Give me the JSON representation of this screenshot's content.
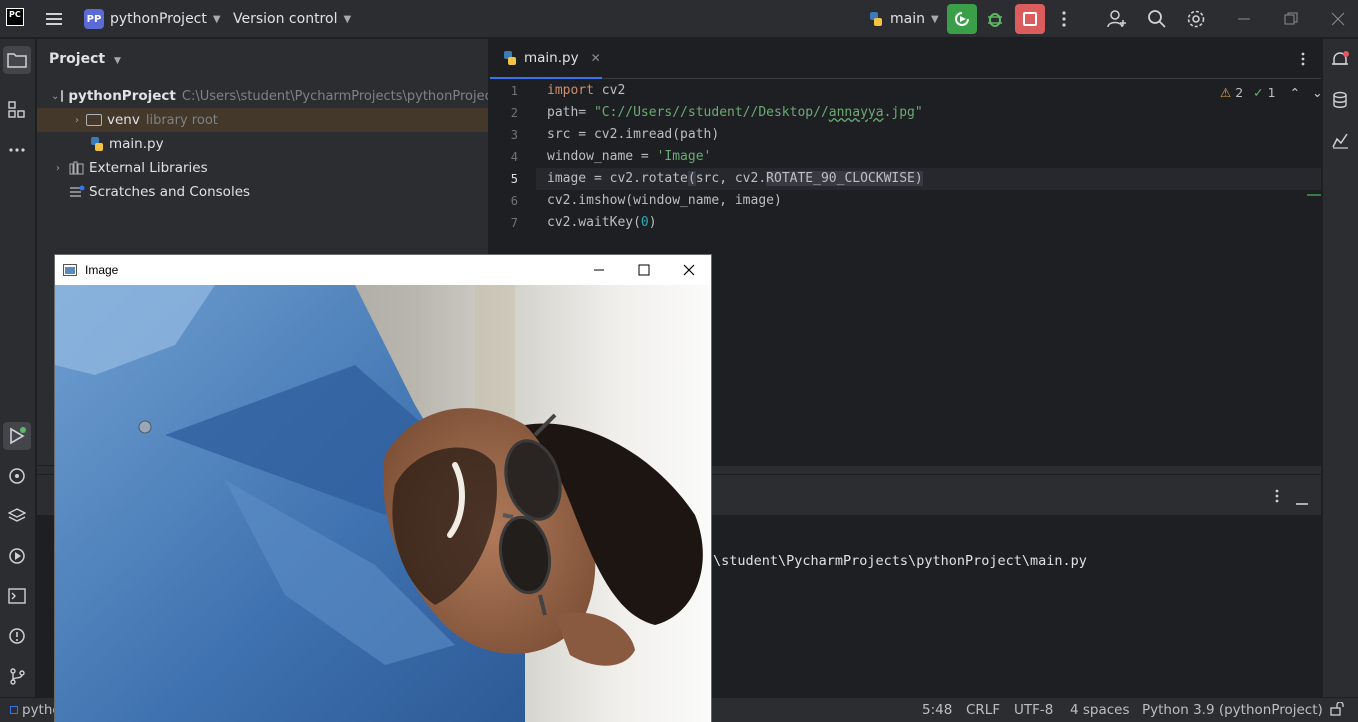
{
  "titlebar": {
    "logo": "PC",
    "project_badge": "PP",
    "project_name": "pythonProject",
    "vcs_label": "Version control",
    "run_config": "main"
  },
  "project_panel": {
    "header": "Project",
    "tree": [
      {
        "label": "pythonProject",
        "hint": "C:\\Users\\student\\PycharmProjects\\pythonProject"
      },
      {
        "label": "venv",
        "hint": "library root"
      },
      {
        "label": "main.py",
        "hint": ""
      },
      {
        "label": "External Libraries",
        "hint": ""
      },
      {
        "label": "Scratches and Consoles",
        "hint": ""
      }
    ]
  },
  "editor": {
    "tab_label": "main.py",
    "warnings": "2",
    "checks": "1",
    "current_line": 5,
    "line_numbers": [
      "1",
      "2",
      "3",
      "4",
      "5",
      "6",
      "7"
    ]
  },
  "terminal": {
    "path_line": "\\student\\PycharmProjects\\pythonProject\\main.py"
  },
  "image_window": {
    "title": "Image"
  },
  "statusbar": {
    "project_crumb": "pytho",
    "position": "5:48",
    "line_sep": "CRLF",
    "encoding": "UTF-8",
    "indent": "4 spaces",
    "interpreter": "Python 3.9 (pythonProject)"
  },
  "colors": {
    "accent": "#3574f0",
    "run": "#3b9f4a",
    "stop": "#db5c5c"
  }
}
